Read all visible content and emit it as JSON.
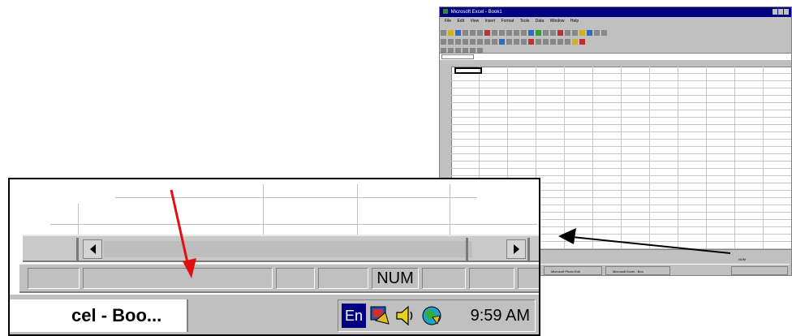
{
  "excel_window": {
    "title": "Microsoft Excel - Book1",
    "menu": [
      "File",
      "Edit",
      "View",
      "Insert",
      "Format",
      "Tools",
      "Data",
      "Window",
      "Help"
    ],
    "status_num": "NUM",
    "taskbar_buttons": [
      "Microsoft Photo Edit",
      "Microsoft Excel - Boo"
    ]
  },
  "zoom": {
    "status_indicator": "NUM",
    "task_button_label": "cel - Boo...",
    "language_indicator": "En",
    "clock": "9:59 AM"
  },
  "colors": {
    "title_bar": "#000080",
    "arrow_red": "#e01010",
    "arrow_black": "#000000"
  },
  "icons": [
    "scroll-left-arrow-icon",
    "scroll-right-arrow-icon",
    "language-icon",
    "speaker-icon",
    "network-icon",
    "display-icon"
  ]
}
